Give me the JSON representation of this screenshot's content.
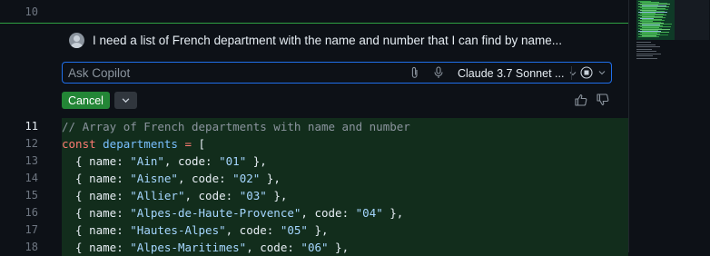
{
  "editor": {
    "top_line_number": "10",
    "colors": {
      "accent_green": "#2ea043",
      "focus_blue": "#1f6feb",
      "diff_bg": "#122d1c"
    }
  },
  "copilot": {
    "prompt_text": "I need a list of French department with the name and number that I can find by name...",
    "input_placeholder": "Ask Copilot",
    "model_label": "Claude 3.7 Sonnet ...",
    "cancel_label": "Cancel",
    "icons": [
      "paperclip-icon",
      "microphone-icon",
      "chevron-down-icon",
      "stop-icon",
      "thumbs-up-icon",
      "thumbs-down-icon"
    ]
  },
  "code_lines": [
    {
      "number": "11",
      "tokens": [
        {
          "t": "// Array of French departments with name and number",
          "c": "com"
        }
      ]
    },
    {
      "number": "12",
      "tokens": [
        {
          "t": "const ",
          "c": "kw"
        },
        {
          "t": "departments ",
          "c": "var"
        },
        {
          "t": "= ",
          "c": "op"
        },
        {
          "t": "[",
          "c": "pl"
        }
      ]
    },
    {
      "number": "13",
      "tokens": [
        {
          "t": "  { ",
          "c": "pl"
        },
        {
          "t": "name: ",
          "c": "pl"
        },
        {
          "t": "\"Ain\"",
          "c": "str"
        },
        {
          "t": ", code: ",
          "c": "pl"
        },
        {
          "t": "\"01\"",
          "c": "str"
        },
        {
          "t": " },",
          "c": "pl"
        }
      ]
    },
    {
      "number": "14",
      "tokens": [
        {
          "t": "  { ",
          "c": "pl"
        },
        {
          "t": "name: ",
          "c": "pl"
        },
        {
          "t": "\"Aisne\"",
          "c": "str"
        },
        {
          "t": ", code: ",
          "c": "pl"
        },
        {
          "t": "\"02\"",
          "c": "str"
        },
        {
          "t": " },",
          "c": "pl"
        }
      ]
    },
    {
      "number": "15",
      "tokens": [
        {
          "t": "  { ",
          "c": "pl"
        },
        {
          "t": "name: ",
          "c": "pl"
        },
        {
          "t": "\"Allier\"",
          "c": "str"
        },
        {
          "t": ", code: ",
          "c": "pl"
        },
        {
          "t": "\"03\"",
          "c": "str"
        },
        {
          "t": " },",
          "c": "pl"
        }
      ]
    },
    {
      "number": "16",
      "tokens": [
        {
          "t": "  { ",
          "c": "pl"
        },
        {
          "t": "name: ",
          "c": "pl"
        },
        {
          "t": "\"Alpes-de-Haute-Provence\"",
          "c": "str"
        },
        {
          "t": ", code: ",
          "c": "pl"
        },
        {
          "t": "\"04\"",
          "c": "str"
        },
        {
          "t": " },",
          "c": "pl"
        }
      ]
    },
    {
      "number": "17",
      "tokens": [
        {
          "t": "  { ",
          "c": "pl"
        },
        {
          "t": "name: ",
          "c": "pl"
        },
        {
          "t": "\"Hautes-Alpes\"",
          "c": "str"
        },
        {
          "t": ", code: ",
          "c": "pl"
        },
        {
          "t": "\"05\"",
          "c": "str"
        },
        {
          "t": " },",
          "c": "pl"
        }
      ]
    },
    {
      "number": "18",
      "tokens": [
        {
          "t": "  { ",
          "c": "pl"
        },
        {
          "t": "name: ",
          "c": "pl"
        },
        {
          "t": "\"Alpes-Maritimes\"",
          "c": "str"
        },
        {
          "t": ", code: ",
          "c": "pl"
        },
        {
          "t": "\"06\"",
          "c": "str"
        },
        {
          "t": " },",
          "c": "pl"
        }
      ]
    }
  ]
}
